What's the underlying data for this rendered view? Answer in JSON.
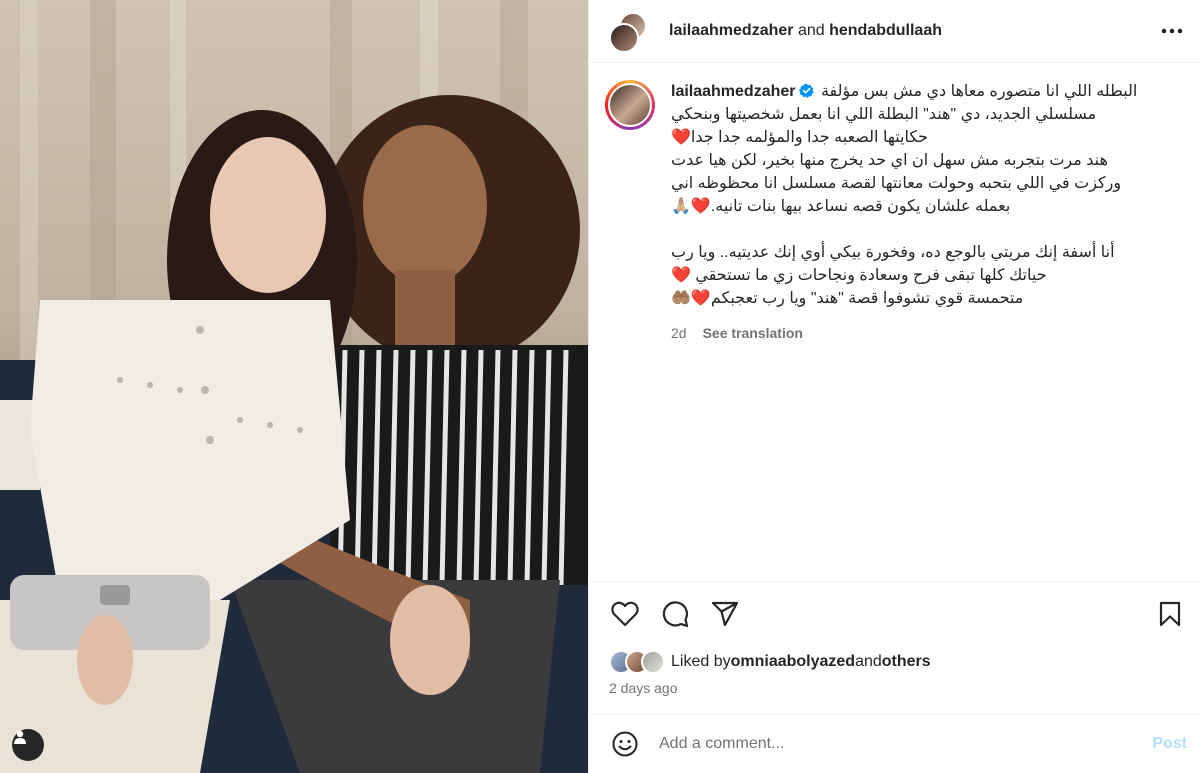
{
  "post": {
    "header": {
      "author": "lailaahmedzaher",
      "connector": " and ",
      "collaborator": "hendabdullaah"
    },
    "caption": {
      "username": "lailaahmedzaher",
      "first_line": "البطله اللي انا متصوره معاها دي مش بس مؤلفة",
      "lines": [
        "مسلسلي الجديد، دي \"هند\" البطلة اللي انا بعمل شخصيتها وبنحكي",
        "حكايتها الصعبه جدا والمؤلمه جدا جدا❤️",
        "هند مرت بتجربه مش سهل ان اي حد يخرج منها بخير، لكن هيا عدت",
        "وركزت في اللي بتحبه وحولت معانتها لقصة مسلسل انا محظوظه اني",
        "بعمله علشان يكون قصه نساعد بيها بنات تانيه.❤️🙏🏼"
      ],
      "lines2": [
        "أنا أسفة إنك مريتي بالوجع ده، وفخورة بيكي أوي إنك عديتيه.. ويا رب",
        "حياتك كلها تبقى فرح وسعادة ونجاحات زي ما تستحقي ❤️",
        "متحمسة قوي تشوفوا قصة \"هند\" ويا رب تعجبكم❤️🤲🏽"
      ],
      "age": "2d",
      "see_translation": "See translation"
    },
    "likes": {
      "prefix": "Liked by ",
      "user": "omniaabolyazed",
      "connector": " and ",
      "others": "others"
    },
    "timestamp": "2 days ago",
    "comment": {
      "placeholder": "Add a comment...",
      "post_label": "Post"
    },
    "icons": {
      "more": "more-options-icon",
      "like": "heart-icon",
      "comment": "comment-icon",
      "share": "share-icon",
      "save": "bookmark-icon",
      "emoji": "emoji-icon",
      "user_tag": "user-tag-icon",
      "verified": "verified-badge-icon"
    },
    "colors": {
      "verified_blue": "#0095f6",
      "post_disabled": "#b2dffc",
      "secondary_text": "#737373"
    }
  }
}
